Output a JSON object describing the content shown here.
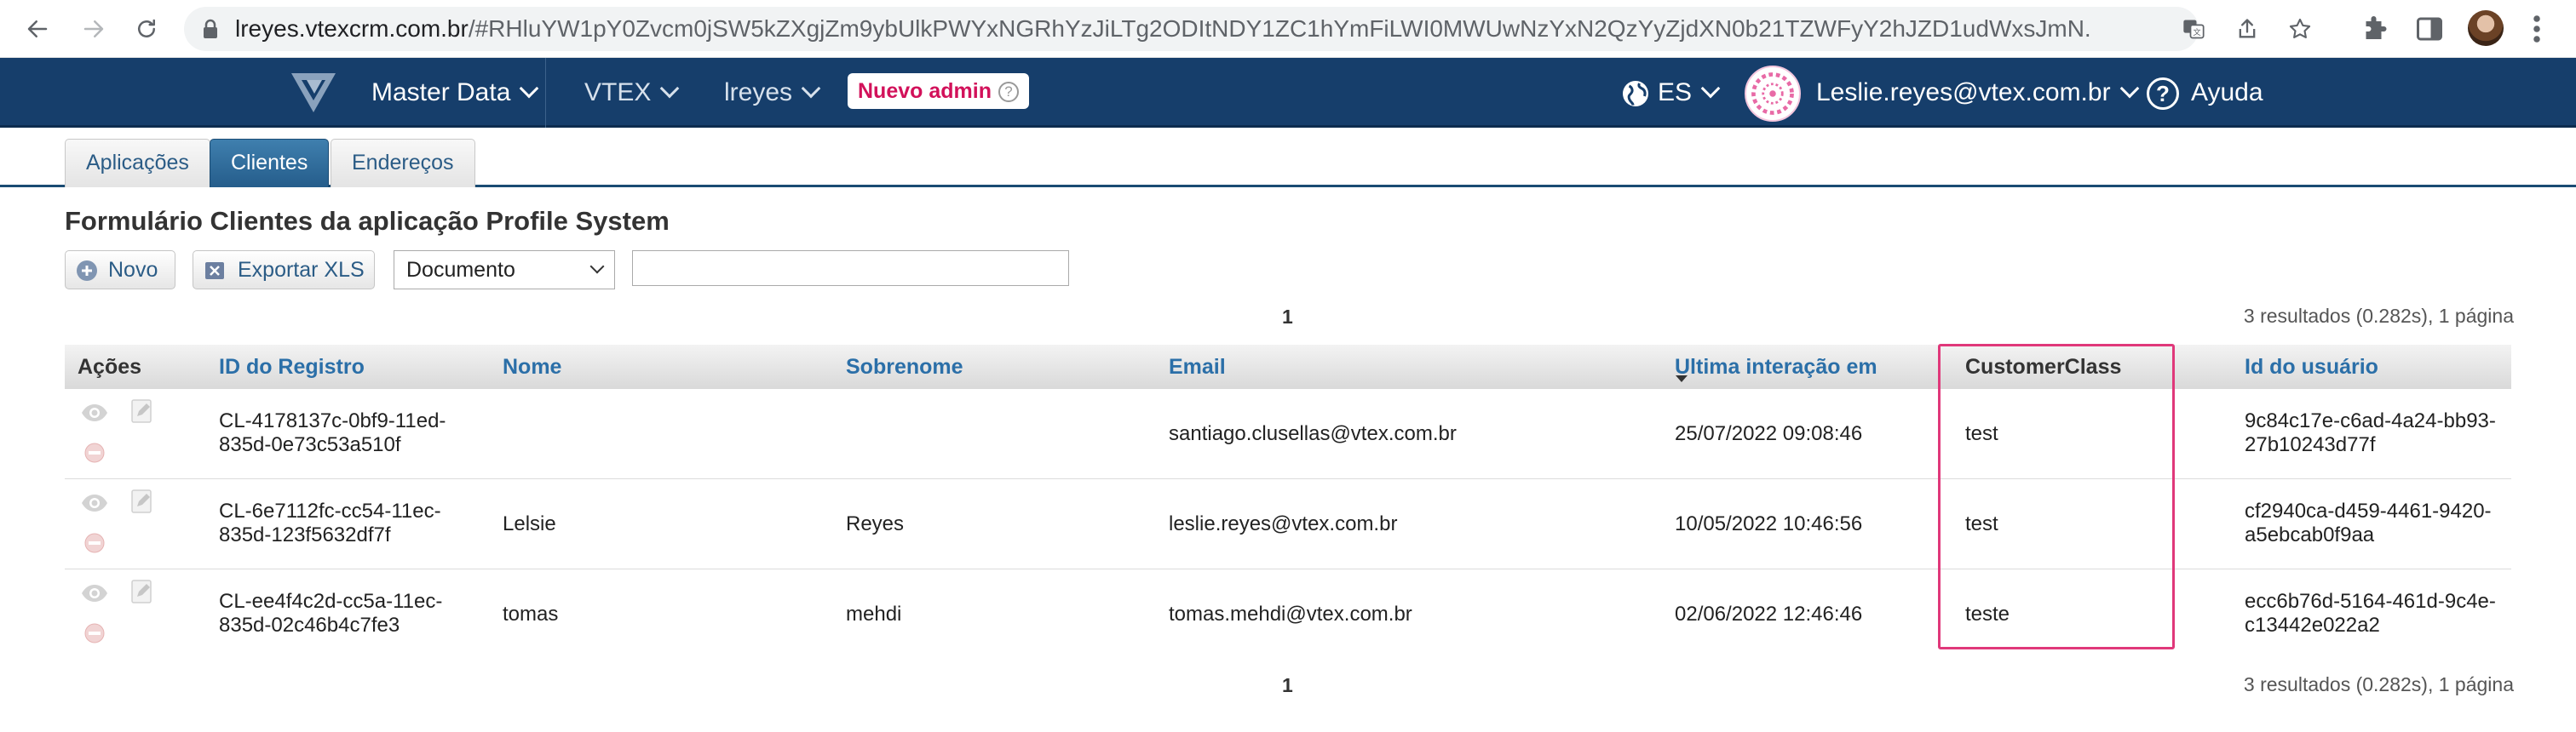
{
  "browser": {
    "url_host": "lreyes.vtexcrm.com.br",
    "url_path": "/#RHluYW1pY0Zvcm0jSW5kZXgjZm9ybUlkPWYxNGRhYzJiLTg2ODItNDY1ZC1hYmFiLWI0MWUwNzYxN2QzYyZjdXN0b21TZWFyY2hJZD1udWxsJmN..."
  },
  "appbar": {
    "product": "Master Data",
    "vtex": "VTEX",
    "account": "lreyes",
    "new_admin": "Nuevo admin",
    "new_admin_help": "?",
    "language": "ES",
    "user": "Leslie.reyes@vtex.com.br",
    "help": "Ayuda"
  },
  "tabs": [
    {
      "label": "Aplicações",
      "active": false
    },
    {
      "label": "Clientes",
      "active": true
    },
    {
      "label": "Endereços",
      "active": false
    }
  ],
  "page": {
    "title": "Formulário Clientes da aplicação Profile System",
    "new_button": "Novo",
    "export_button": "Exportar XLS",
    "search_field": "Documento",
    "search_value": "",
    "page_number": "1",
    "results": "3 resultados (0.282s), 1 página"
  },
  "table": {
    "headers": [
      "Ações",
      "ID do Registro",
      "Nome",
      "Sobrenome",
      "Email",
      "Ultima interação em",
      "CustomerClass",
      "Id do usuário"
    ],
    "rows": [
      {
        "id_line1": "CL-4178137c-0bf9-11ed-",
        "id_line2": "835d-0e73c53a510f",
        "nome": "",
        "sobrenome": "",
        "email": "santiago.clusellas@vtex.com.br",
        "ultima": "25/07/2022 09:08:46",
        "customer_class": "test",
        "user_line1": "9c84c17e-c6ad-4a24-bb93-",
        "user_line2": "27b10243d77f"
      },
      {
        "id_line1": "CL-6e7112fc-cc54-11ec-",
        "id_line2": "835d-123f5632df7f",
        "nome": "Lelsie",
        "sobrenome": "Reyes",
        "email": "leslie.reyes@vtex.com.br",
        "ultima": "10/05/2022 10:46:56",
        "customer_class": "test",
        "user_line1": "cf2940ca-d459-4461-9420-",
        "user_line2": "a5ebcab0f9aa"
      },
      {
        "id_line1": "CL-ee4f4c2d-cc5a-11ec-",
        "id_line2": "835d-02c46b4c7fe3",
        "nome": "tomas",
        "sobrenome": "mehdi",
        "email": "tomas.mehdi@vtex.com.br",
        "ultima": "02/06/2022 12:46:46",
        "customer_class": "teste",
        "user_line1": "ecc6b76d-5164-461d-9c4e-",
        "user_line2": "c13442e022a2"
      }
    ]
  },
  "colors": {
    "appbar": "#163e6b",
    "header_link": "#2b6fa8",
    "highlight": "#e0387a",
    "new_admin": "#d2115a"
  },
  "icons": [
    "back-icon",
    "forward-icon",
    "reload-icon",
    "lock-icon",
    "translate-icon",
    "share-icon",
    "star-icon",
    "extensions-icon",
    "sidebar-icon",
    "menu-icon",
    "vtex-logo",
    "globe-icon",
    "help-icon",
    "add-icon",
    "excel-icon",
    "view-icon",
    "edit-icon",
    "delete-icon"
  ]
}
